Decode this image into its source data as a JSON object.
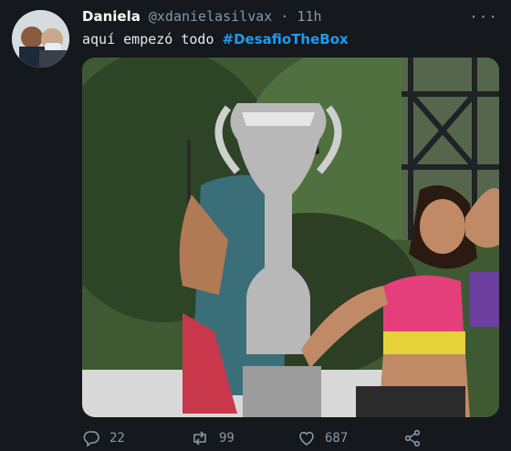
{
  "tweet": {
    "display_name": "Daniela",
    "handle": "@xdanielasilvax",
    "separator": "·",
    "time": "11h",
    "text": "aquí empezó todo",
    "hashtag": "#DesafioTheBox",
    "more_icon": "ellipsis-icon"
  },
  "actions": {
    "replies": "22",
    "retweets": "99",
    "likes": "687"
  },
  "colors": {
    "background": "#15181c",
    "accent": "#1d9bf0",
    "muted": "#8b98a5"
  }
}
